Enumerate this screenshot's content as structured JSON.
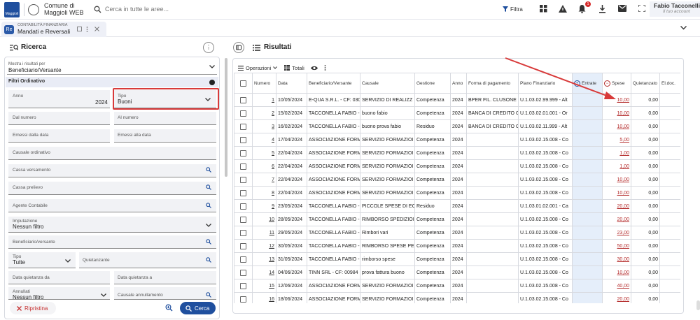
{
  "header": {
    "logo_text": "Maggioli",
    "app_title_line1": "Comune di",
    "app_title_line2": "Maggioli WEB",
    "search_placeholder": "Cerca in tutte le aree...",
    "filter_label": "Filtra",
    "notification_count": "1",
    "user_name": "Fabio Tacconelli",
    "user_sub": "Il tuo account"
  },
  "tab": {
    "icon_text": "Re",
    "small": "CONTABILITÀ FINANZIARIA",
    "main": "Mandati e Reversali"
  },
  "search_panel": {
    "title": "Ricerca",
    "show_label": "Mostra i risultati per",
    "show_value": "Beneficiario/Versante",
    "filters_title": "Filtri Ordinativo",
    "fields": {
      "anno_label": "Anno",
      "anno_value": "2024",
      "tipo_label": "Tipo",
      "tipo_value": "Buoni",
      "dal_numero": "Dal numero",
      "al_numero": "Al numero",
      "emessi_dalla": "Emessi dalla data",
      "emessi_alla": "Emessi alla data",
      "causale": "Causale ordinativo",
      "cassa_versamento": "Cassa versamento",
      "cassa_prelievo": "Cassa prelievo",
      "agente": "Agente Contabile",
      "imputazione_label": "Imputazione",
      "imputazione_value": "Nessun filtro",
      "beneficiario": "Beneficiario/versante",
      "tipo2_label": "Tipo",
      "tipo2_value": "Tutte",
      "quietanzante": "Quietanzante",
      "data_quietanza_da": "Data quietanza da",
      "data_quietanza_a": "Data quietanza a",
      "annullati_label": "Annullati",
      "annullati_value": "Nessun filtro",
      "causale_annullamento": "Causale annullamento"
    },
    "reset_label": "Ripristina",
    "search_label": "Cerca"
  },
  "results": {
    "title": "Risultati",
    "toolbar": {
      "operazioni": "Operazioni",
      "totali": "Totali"
    },
    "columns": [
      "Numero",
      "Data",
      "Beneficiario/Versante",
      "Causale",
      "Gestione",
      "Anno",
      "Forma di pagamento",
      "Piano Finanziario",
      "Entrate",
      "Spese",
      "Quietanzato",
      "El.doc."
    ],
    "rows": [
      [
        "1",
        "10/05/2024",
        "E-QUA S.R.L. - CF: 030",
        "SERVIZIO DI REALIZZ",
        "Competenza",
        "2024",
        "BPER FIL. CLUSONE C",
        "U.1.03.02.99.999 - Alt",
        "",
        "10,00",
        "0,00",
        ""
      ],
      [
        "2",
        "15/02/2024",
        "TACCONELLA FABIO -",
        "buono fabio",
        "Competenza",
        "2024",
        "BANCA DI CREDITO C",
        "U.1.03.02.01.001 - Or",
        "",
        "10,00",
        "0,00",
        ""
      ],
      [
        "3",
        "16/02/2024",
        "TACCONELLA FABIO -",
        "buono prova fabio",
        "Residuo",
        "2024",
        "BANCA DI CREDITO C",
        "U.1.03.02.11.999 - Alt",
        "",
        "10,00",
        "0,00",
        ""
      ],
      [
        "4",
        "17/04/2024",
        "ASSOCIAZIONE FORM",
        "SERVIZIO FORMAZIOI",
        "Competenza",
        "2024",
        "",
        "U.1.03.02.15.008 - Co",
        "",
        "5,00",
        "0,00",
        ""
      ],
      [
        "5",
        "22/04/2024",
        "ASSOCIAZIONE FORM",
        "SERVIZIO FORMAZIOI",
        "Competenza",
        "2024",
        "",
        "U.1.03.02.15.008 - Co",
        "",
        "1,00",
        "0,00",
        ""
      ],
      [
        "6",
        "22/04/2024",
        "ASSOCIAZIONE FORM",
        "SERVIZIO FORMAZIOI",
        "Competenza",
        "2024",
        "",
        "U.1.03.02.15.008 - Co",
        "",
        "1,00",
        "0,00",
        ""
      ],
      [
        "7",
        "22/04/2024",
        "ASSOCIAZIONE FORM",
        "SERVIZIO FORMAZIOI",
        "Competenza",
        "2024",
        "",
        "U.1.03.02.15.008 - Co",
        "",
        "10,00",
        "0,00",
        ""
      ],
      [
        "8",
        "22/04/2024",
        "ASSOCIAZIONE FORM",
        "SERVIZIO FORMAZIOI",
        "Competenza",
        "2024",
        "",
        "U.1.03.02.15.008 - Co",
        "",
        "10,00",
        "0,00",
        ""
      ],
      [
        "9",
        "23/05/2024",
        "TACCONELLA FABIO -",
        "PICCOLE SPESE DI EC",
        "Residuo",
        "2024",
        "",
        "U.1.03.01.02.001 - Ca",
        "",
        "20,00",
        "0,00",
        ""
      ],
      [
        "10",
        "28/05/2024",
        "TACCONELLA FABIO -",
        "RIMBORSO SPEDIZIOI",
        "Competenza",
        "2024",
        "",
        "U.1.03.02.15.008 - Co",
        "",
        "20,00",
        "0,00",
        ""
      ],
      [
        "11",
        "29/05/2024",
        "TACCONELLA FABIO -",
        "Rimbori vari",
        "Competenza",
        "2024",
        "",
        "U.1.03.02.15.008 - Co",
        "",
        "23,00",
        "0,00",
        ""
      ],
      [
        "12",
        "30/05/2024",
        "TACCONELLA FABIO -",
        "RIMBORSO SPESE PE",
        "Competenza",
        "2024",
        "",
        "U.1.03.02.15.008 - Co",
        "",
        "50,00",
        "0,00",
        ""
      ],
      [
        "13",
        "31/05/2024",
        "TACCONELLA FABIO -",
        "rimborso spese",
        "Competenza",
        "2024",
        "",
        "U.1.03.02.15.008 - Co",
        "",
        "30,00",
        "0,00",
        ""
      ],
      [
        "14",
        "04/06/2024",
        "TINN SRL - CF: 00984",
        "prova fattura buono",
        "Competenza",
        "2024",
        "",
        "U.1.03.02.15.008 - Co",
        "",
        "10,00",
        "0,00",
        ""
      ],
      [
        "15",
        "12/06/2024",
        "ASSOCIAZIONE FORM",
        "SERVIZIO FORMAZIOI",
        "Competenza",
        "2024",
        "",
        "U.1.03.02.15.008 - Co",
        "",
        "40,00",
        "0,00",
        ""
      ],
      [
        "16",
        "18/06/2024",
        "ASSOCIAZIONE FORM",
        "SERVIZIO FORMAZIOI",
        "Competenza",
        "2024",
        "",
        "U.1.03.02.15.008 - Co",
        "",
        "20,00",
        "0,00",
        ""
      ]
    ]
  },
  "colors": {
    "primary": "#1f4f9e",
    "highlight_red": "#d83a3a",
    "spese_red": "#b52e2e",
    "entrate_bg": "#e5eefa",
    "filters_bg": "#e9ecf6"
  }
}
